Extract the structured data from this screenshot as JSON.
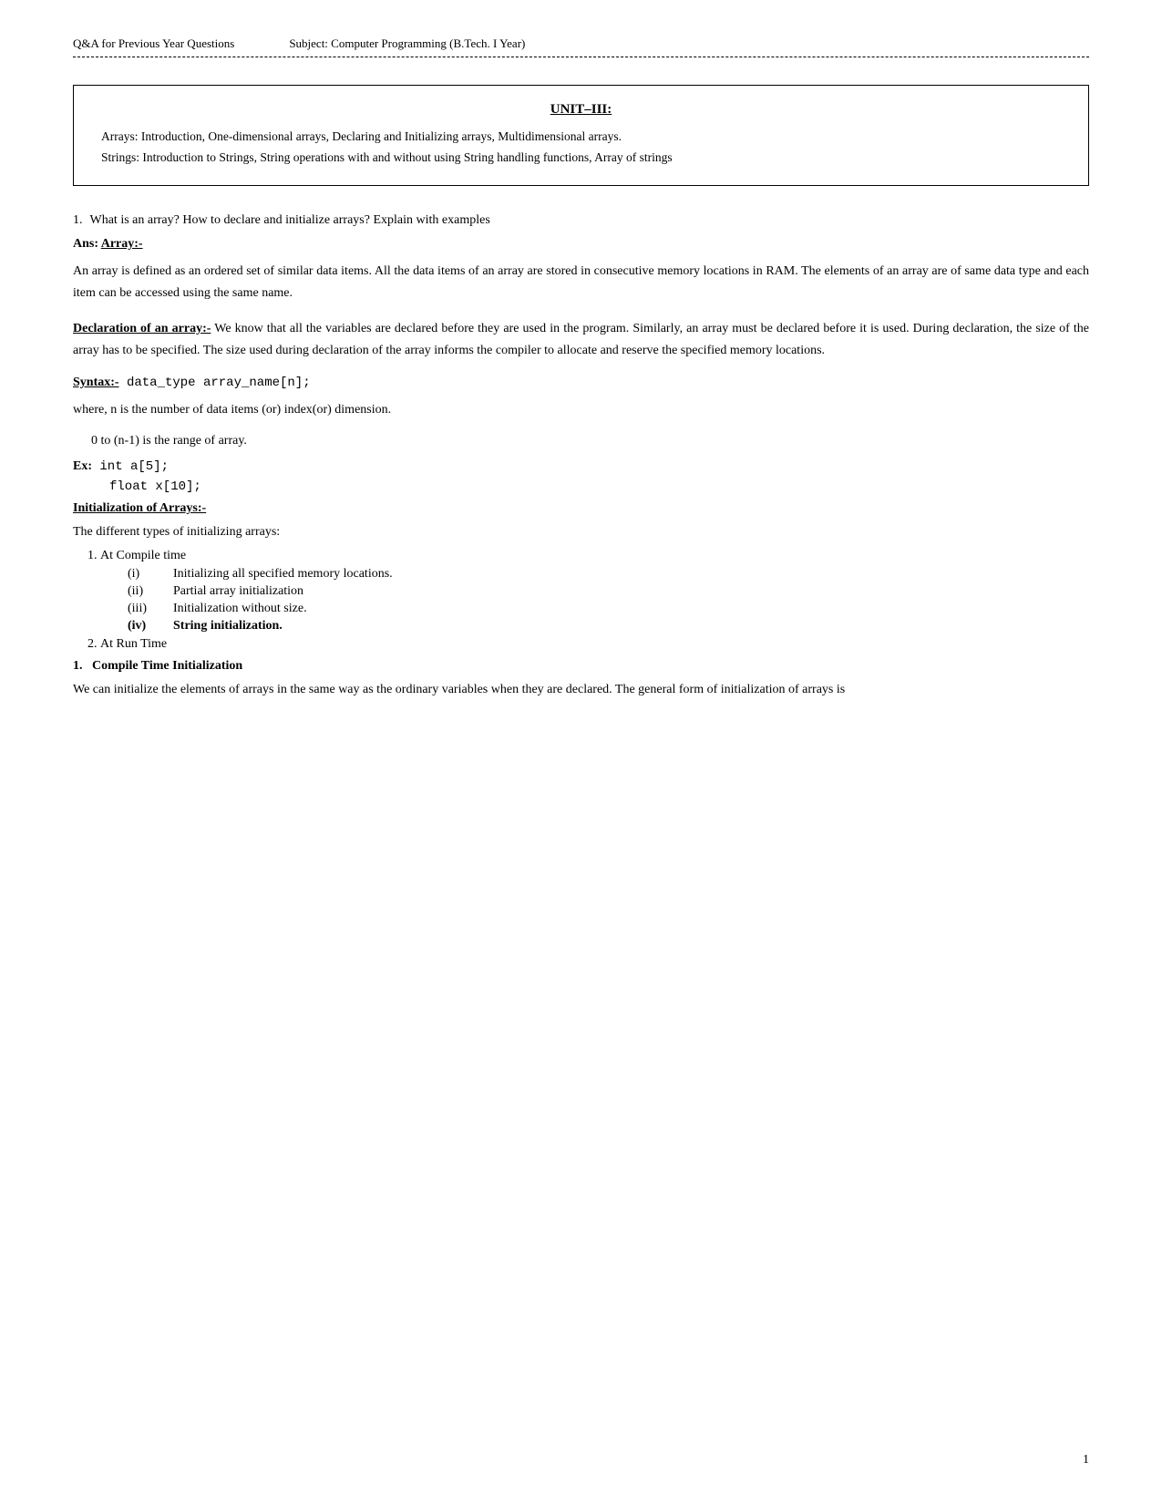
{
  "header": {
    "left": "Q&A  for Previous Year Questions",
    "right": "Subject: Computer Programming (B.Tech. I Year)"
  },
  "unit_box": {
    "title": "UNIT–III:",
    "line1": "Arrays:  Introduction,  One-dimensional  arrays,  Declaring  and  Initializing  arrays, Multidimensional arrays.",
    "line2": "Strings:  Introduction to Strings, String operations with and without using String handling functions, Array of strings"
  },
  "question1": {
    "number": "1.",
    "text": "What is an array? How to declare and initialize arrays? Explain with examples"
  },
  "answer_heading": "Ans: Array:-",
  "array_definition": "An array is defined as an ordered set of similar data items. All the data items of an array are stored in consecutive memory locations in RAM. The elements of an array are of same data type and each item can be accessed using the same name.",
  "declaration_section": {
    "heading": "Declaration of an array:-",
    "text": " We know that all the variables are declared before they are used in the program. Similarly, an array must be declared before it is used. During declaration, the size of the array has to be specified. The size used during declaration of the array informs the compiler to allocate and reserve the specified memory locations."
  },
  "syntax_section": {
    "label": "Syntax:-",
    "code": "  data_type  array_name[n];"
  },
  "where_line": "where, n is the number of data items (or) index(or) dimension.",
  "range_line": "0 to (n-1) is the range of array.",
  "ex_section": {
    "label": "Ex:",
    "line1": " int    a[5];",
    "line2": "float  x[10];"
  },
  "initialization_heading": "Initialization of Arrays:-",
  "init_intro": "The different types of initializing arrays:",
  "compile_time_items": [
    {
      "num": "(i)",
      "text": "Initializing all specified memory locations."
    },
    {
      "num": "(ii)",
      "text": "Partial array initialization"
    },
    {
      "num": "(iii)",
      "text": "Initialization without size."
    },
    {
      "num": "(iv)",
      "text": "String initialization.",
      "bold": true
    }
  ],
  "outer_list": [
    {
      "num": "1.",
      "text": "At Compile time"
    },
    {
      "num": "2.",
      "text": "At Run Time"
    }
  ],
  "compile_time_init": {
    "heading": "1.   Compile Time Initialization",
    "text": "We can initialize the elements of arrays in the same way as the ordinary variables when they are declared. The general form of initialization of arrays is"
  },
  "page_number": "1"
}
